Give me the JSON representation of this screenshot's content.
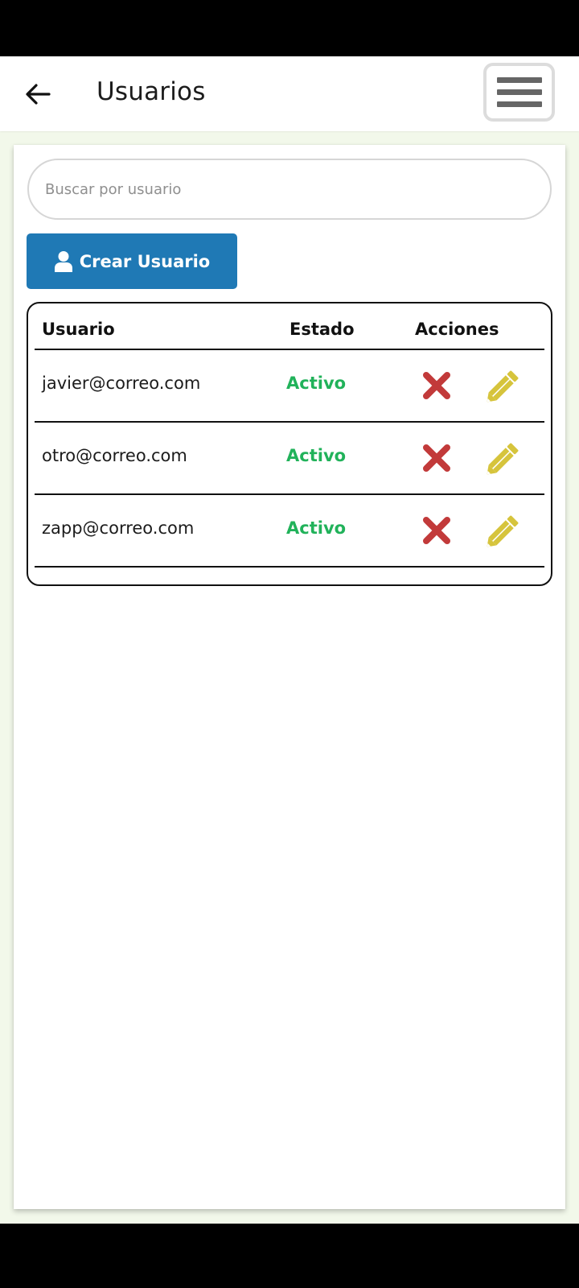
{
  "app_bar": {
    "title": "Usuarios",
    "back_icon": "arrow-left-icon",
    "menu_icon": "hamburger-menu-icon"
  },
  "search": {
    "placeholder": "Buscar por usuario",
    "value": ""
  },
  "create_button": {
    "label": "Crear Usuario",
    "icon": "user-icon"
  },
  "table": {
    "headers": {
      "user": "Usuario",
      "state": "Estado",
      "actions": "Acciones"
    },
    "rows": [
      {
        "email": "javier@correo.com",
        "status": "Activo"
      },
      {
        "email": "otro@correo.com",
        "status": "Activo"
      },
      {
        "email": "zapp@correo.com",
        "status": "Activo"
      }
    ],
    "action_icons": [
      "delete-x-icon",
      "edit-pencil-icon"
    ]
  },
  "colors": {
    "primary_button": "#1f79b5",
    "status_active": "#21b25a",
    "delete": "#c23a3a",
    "edit": "#d6c43c",
    "page_background": "#f2f8ea"
  }
}
